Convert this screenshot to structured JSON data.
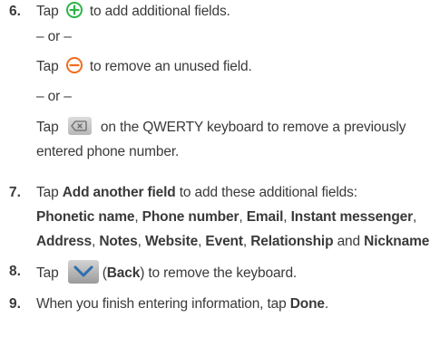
{
  "icons": {
    "plus": "plus-circle-icon",
    "minus": "minus-circle-icon",
    "backspace": "backspace-key-icon",
    "back": "back-chevron-icon"
  },
  "colors": {
    "text": "#3a3a3a",
    "plus_icon": "#2db34a",
    "minus_icon": "#f26b21",
    "back_icon": "#2a6fb0"
  },
  "step6": {
    "number": "6.",
    "line1_a": "Tap",
    "line1_b": "to add additional fields.",
    "or1": "– or –",
    "line2_a": "Tap",
    "line2_b": "to remove an unused field.",
    "or2": "– or –",
    "line3_a": "Tap",
    "line3_b": "on the QWERTY keyboard to remove a previously",
    "line4": "entered phone number."
  },
  "step7": {
    "number": "7.",
    "line1_a": "Tap ",
    "line1_bold": "Add another field",
    "line1_b": " to add these additional fields:",
    "fields_line1": [
      {
        "t": "Phonetic name",
        "b": true
      },
      {
        "t": ", ",
        "b": false
      },
      {
        "t": "Phone number",
        "b": true
      },
      {
        "t": ", ",
        "b": false
      },
      {
        "t": "Email",
        "b": true
      },
      {
        "t": ", ",
        "b": false
      },
      {
        "t": "Instant messenger",
        "b": true
      },
      {
        "t": ",",
        "b": false
      }
    ],
    "fields_line2": [
      {
        "t": "Address",
        "b": true
      },
      {
        "t": ", ",
        "b": false
      },
      {
        "t": "Notes",
        "b": true
      },
      {
        "t": ", ",
        "b": false
      },
      {
        "t": "Website",
        "b": true
      },
      {
        "t": ", ",
        "b": false
      },
      {
        "t": "Event",
        "b": true
      },
      {
        "t": ", ",
        "b": false
      },
      {
        "t": "Relationship",
        "b": true
      },
      {
        "t": " and ",
        "b": false
      },
      {
        "t": "Nickname",
        "b": true
      },
      {
        "t": ".",
        "b": false
      }
    ]
  },
  "step8": {
    "number": "8.",
    "a": "Tap",
    "paren_open": "(",
    "bold": "Back",
    "paren_close": ")",
    "b": " to remove the keyboard."
  },
  "step9": {
    "number": "9.",
    "a": "When you finish entering information, tap ",
    "bold": "Done",
    "b": "."
  }
}
